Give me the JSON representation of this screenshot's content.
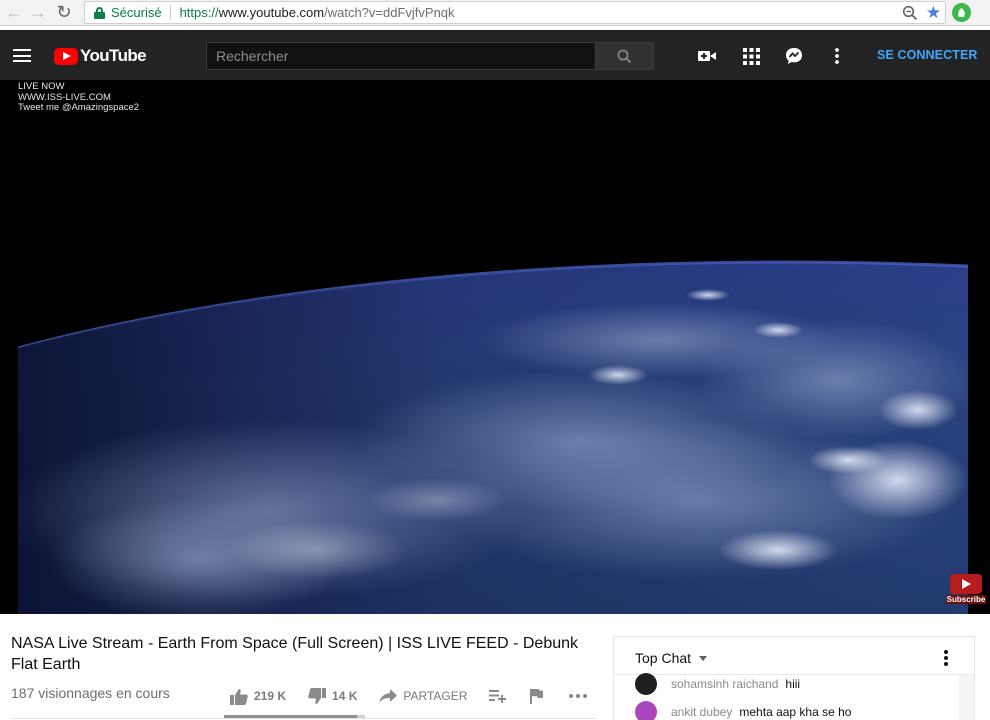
{
  "browser": {
    "secure_label": "Sécurisé",
    "url_scheme": "https://",
    "url_host": "www.youtube.com",
    "url_path": "/watch?v=ddFvjfvPnqk"
  },
  "header": {
    "logo_text": "YouTube",
    "search_placeholder": "Rechercher",
    "signin_label": "SE CONNECTER"
  },
  "player": {
    "overlay_lines": [
      "LIVE NOW",
      "WWW.ISS-LIVE.COM",
      "Tweet me @Amazingspace2"
    ],
    "subscribe_label": "Subscribe"
  },
  "video": {
    "title": "NASA Live Stream - Earth From Space (Full Screen) | ISS LIVE FEED - Debunk Flat Earth",
    "views": "187 visionnages en cours",
    "likes": "219 K",
    "dislikes": "14 K",
    "share_label": "PARTAGER",
    "like_ratio": 0.94
  },
  "chat": {
    "title": "Top Chat",
    "messages": [
      {
        "author": "sohamsinh raichand",
        "text": "hiii",
        "avatar_color": "#1f1f1f"
      },
      {
        "author": "ankit dubey",
        "text": "mehta aap kha se ho",
        "avatar_color": "#ab47bc"
      }
    ]
  },
  "colors": {
    "brand_red": "#ff0000",
    "header_bg": "#232323",
    "link_blue": "#3ea6ff",
    "secure_green": "#0b8043"
  },
  "icons": [
    "back-arrow-icon",
    "forward-arrow-icon",
    "reload-icon",
    "lock-icon",
    "zoom-icon",
    "star-icon",
    "extension-icon",
    "menu-icon",
    "youtube-logo-icon",
    "search-icon",
    "create-video-icon",
    "apps-grid-icon",
    "messages-icon",
    "more-vert-icon",
    "thumb-up-icon",
    "thumb-down-icon",
    "share-icon",
    "add-to-playlist-icon",
    "flag-icon",
    "more-horiz-icon"
  ]
}
